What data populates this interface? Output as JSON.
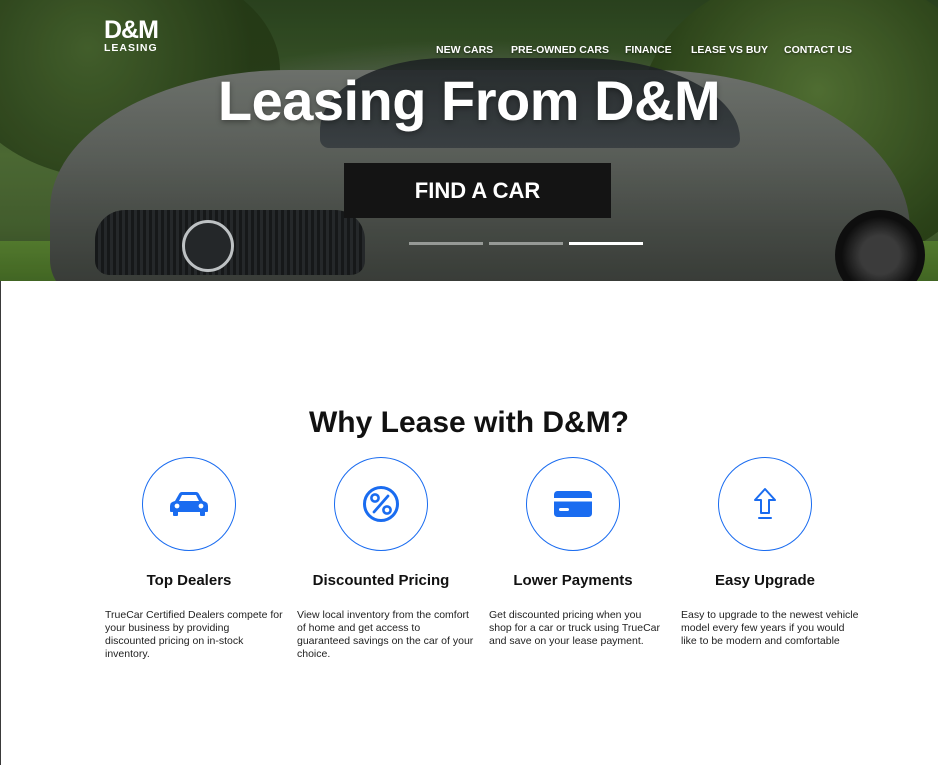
{
  "brand": {
    "logo_top": "D&M",
    "logo_bottom": "LEASING"
  },
  "nav": {
    "items": [
      "NEW CARS",
      "PRE-OWNED CARS",
      "FINANCE",
      "LEASE VS BUY",
      "CONTACT US"
    ]
  },
  "hero": {
    "title": "Leasing From D&M",
    "cta_label": "FIND A CAR",
    "slides": 3,
    "active_slide": 3
  },
  "why": {
    "title": "Why Lease with D&M?",
    "features": [
      {
        "icon": "car-icon",
        "title": "Top Dealers",
        "desc": "TrueCar Certified Dealers compete for your business by providing discounted pricing on in-stock inventory."
      },
      {
        "icon": "percent-icon",
        "title": "Discounted Pricing",
        "desc": "View local inventory from the comfort of home and get access to guaranteed savings on the car of your choice."
      },
      {
        "icon": "credit-card-icon",
        "title": "Lower Payments",
        "desc": "Get discounted pricing when you shop for a car or truck using TrueCar and save on your lease payment."
      },
      {
        "icon": "upgrade-arrow-icon",
        "title": "Easy Upgrade",
        "desc": "Easy to upgrade to the newest vehicle model every few years if you would like to be modern and comfortable"
      }
    ]
  },
  "colors": {
    "accent": "#1a6cf0",
    "cta_bg": "#141414",
    "text": "#111111"
  }
}
